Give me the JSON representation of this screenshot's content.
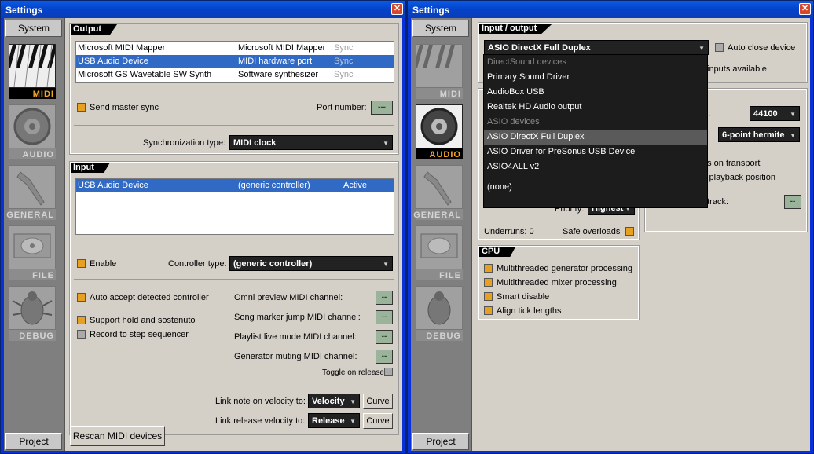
{
  "left": {
    "title": "Settings",
    "close": "✕",
    "sidebar": {
      "top_tab": "System",
      "bottom_tab": "Project",
      "categories": [
        {
          "label": "MIDI",
          "icon": "piano-keys-icon"
        },
        {
          "label": "AUDIO",
          "icon": "speaker-icon"
        },
        {
          "label": "GENERAL",
          "icon": "wrench-icon"
        },
        {
          "label": "FILE",
          "icon": "disc-icon"
        },
        {
          "label": "DEBUG",
          "icon": "bug-icon"
        }
      ],
      "active": "MIDI"
    },
    "output": {
      "title": "Output",
      "rows": [
        {
          "name": "Microsoft MIDI Mapper",
          "type": "Microsoft MIDI Mapper",
          "sync": "Sync"
        },
        {
          "name": "USB Audio Device",
          "type": "MIDI hardware port",
          "sync": "Sync"
        },
        {
          "name": "Microsoft GS Wavetable SW Synth",
          "type": "Software synthesizer",
          "sync": "Sync"
        }
      ],
      "send_master_sync": "Send master sync",
      "port_number_label": "Port number:",
      "port_number_value": "---",
      "sync_type_label": "Synchronization type:",
      "sync_type_value": "MIDI clock"
    },
    "input": {
      "title": "Input",
      "rows": [
        {
          "name": "USB Audio Device",
          "controller": "(generic controller)",
          "status": "Active"
        }
      ],
      "enable": "Enable",
      "controller_type_label": "Controller type:",
      "controller_type_value": "(generic controller)",
      "auto_accept": "Auto accept detected controller",
      "support_hold": "Support hold and sostenuto",
      "record_step": "Record to step sequencer",
      "omni_preview": "Omni preview MIDI channel:",
      "song_marker": "Song marker jump MIDI channel:",
      "playlist_live": "Playlist live mode MIDI channel:",
      "generator_muting": "Generator muting MIDI channel:",
      "channel_value": "--",
      "toggle_on_release": "Toggle on release",
      "link_note_label": "Link note on velocity to:",
      "link_note_value": "Velocity",
      "link_release_label": "Link release velocity to:",
      "link_release_value": "Release",
      "curve": "Curve"
    },
    "rescan": "Rescan MIDI devices"
  },
  "right": {
    "title": "Settings",
    "close": "✕",
    "sidebar": {
      "top_tab": "System",
      "bottom_tab": "Project",
      "active": "AUDIO"
    },
    "io": {
      "title": "Input / output",
      "device_value": "ASIO DirectX Full Duplex",
      "auto_close": "Auto close device",
      "inputs_available": "inputs available",
      "sample_rate_label": "z):",
      "sample_rate_value": "44100",
      "interp_value": "6-point hermite",
      "on_transport": "ns on transport",
      "playback_position": "s playback position",
      "preview_mixer_label": "Preview mixer track:",
      "preview_mixer_value": "--",
      "priority_label": "Priority:",
      "priority_value": "Highest",
      "underruns": "Underruns: 0",
      "safe_overloads": "Safe overloads"
    },
    "dropdown": {
      "items": [
        {
          "label": "DirectSound devices",
          "kind": "head"
        },
        {
          "label": "Primary Sound Driver",
          "kind": "item"
        },
        {
          "label": "AudioBox USB",
          "kind": "item"
        },
        {
          "label": "Realtek HD Audio output",
          "kind": "item"
        },
        {
          "label": "ASIO devices",
          "kind": "head"
        },
        {
          "label": "ASIO DirectX Full Duplex",
          "kind": "hl"
        },
        {
          "label": "ASIO Driver for PreSonus USB Device",
          "kind": "item"
        },
        {
          "label": "ASIO4ALL v2",
          "kind": "item"
        },
        {
          "label": "",
          "kind": "item"
        },
        {
          "label": "(none)",
          "kind": "item"
        }
      ]
    },
    "cpu": {
      "title": "CPU",
      "items": [
        "Multithreaded generator processing",
        "Multithreaded mixer processing",
        "Smart disable",
        "Align tick lengths"
      ]
    }
  }
}
